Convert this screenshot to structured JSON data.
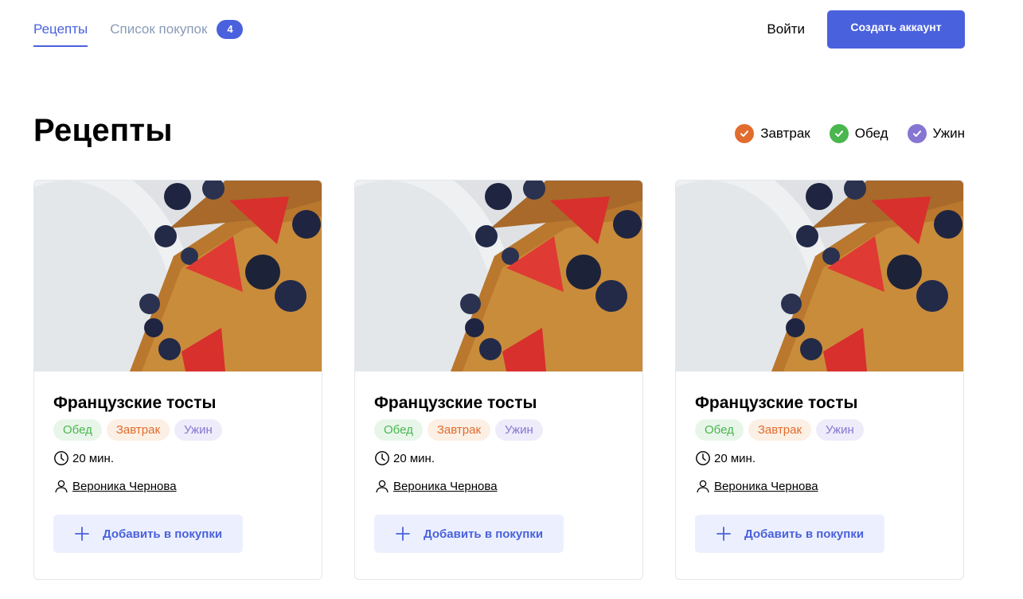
{
  "nav": {
    "tabs": [
      {
        "label": "Рецепты",
        "active": true
      },
      {
        "label": "Список покупок",
        "badge": "4"
      }
    ],
    "login_label": "Войти",
    "signup_label": "Создать аккаунт"
  },
  "page": {
    "title": "Рецепты",
    "filters": [
      {
        "label": "Завтрак",
        "color": "#e26c2d",
        "checked": true
      },
      {
        "label": "Обед",
        "color": "#49b64e",
        "checked": true
      },
      {
        "label": "Ужин",
        "color": "#8775d2",
        "checked": true
      }
    ]
  },
  "colors": {
    "accent": "#4a61dd",
    "lunch": "#49b64e",
    "breakfast": "#e26c2d",
    "dinner": "#8775d2"
  },
  "recipes": [
    {
      "title": "Французские тосты",
      "tags": [
        "Обед",
        "Завтрак",
        "Ужин"
      ],
      "time": "20 мин.",
      "author": "Вероника Чернова",
      "add_label": "Добавить в покупки"
    },
    {
      "title": "Французские тосты",
      "tags": [
        "Обед",
        "Завтрак",
        "Ужин"
      ],
      "time": "20 мин.",
      "author": "Вероника Чернова",
      "add_label": "Добавить в покупки"
    },
    {
      "title": "Французские тосты",
      "tags": [
        "Обед",
        "Завтрак",
        "Ужин"
      ],
      "time": "20 мин.",
      "author": "Вероника Чернова",
      "add_label": "Добавить в покупки"
    }
  ]
}
